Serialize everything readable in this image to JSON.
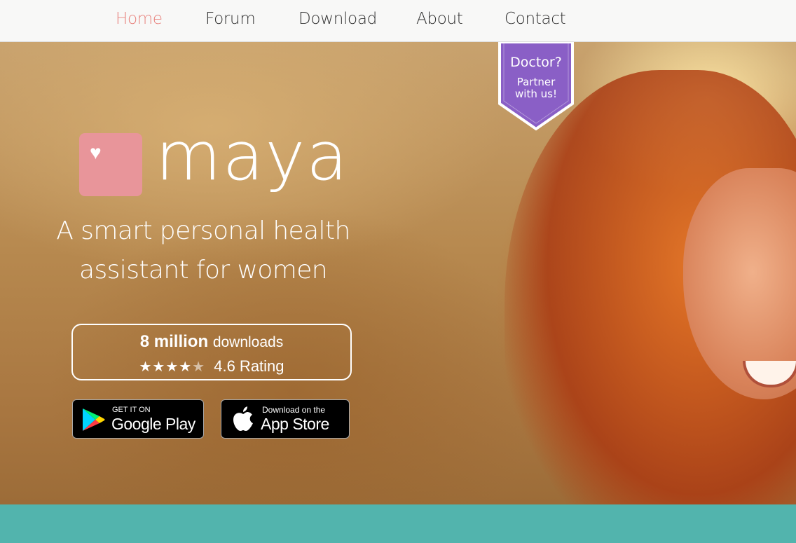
{
  "nav": {
    "items": [
      {
        "label": "Home",
        "active": true
      },
      {
        "label": "Forum",
        "active": false
      },
      {
        "label": "Download",
        "active": false
      },
      {
        "label": "About",
        "active": false
      },
      {
        "label": "Contact",
        "active": false
      }
    ],
    "active_color": "#e8837e"
  },
  "ribbon": {
    "title": "Doctor?",
    "line1": "Partner",
    "line2": "with us!",
    "color": "#8a5fc6"
  },
  "brand": {
    "name": "maya",
    "icon": "heart-icon",
    "icon_bg": "#e8959a"
  },
  "hero": {
    "tagline_line1": "A smart personal health",
    "tagline_line2": "assistant for women"
  },
  "stats": {
    "downloads_count": "8 million",
    "downloads_label": "downloads",
    "stars_glyph": "★★★★",
    "half_star_glyph": "★",
    "rating": 4.6,
    "rating_text": "4.6 Rating"
  },
  "badges": {
    "google": {
      "small": "GET IT ON",
      "big": "Google Play",
      "icon": "google-play-icon"
    },
    "apple": {
      "small": "Download on the",
      "big": "App Store",
      "icon": "apple-icon"
    }
  },
  "colors": {
    "teal_strip": "#52b4ad"
  }
}
